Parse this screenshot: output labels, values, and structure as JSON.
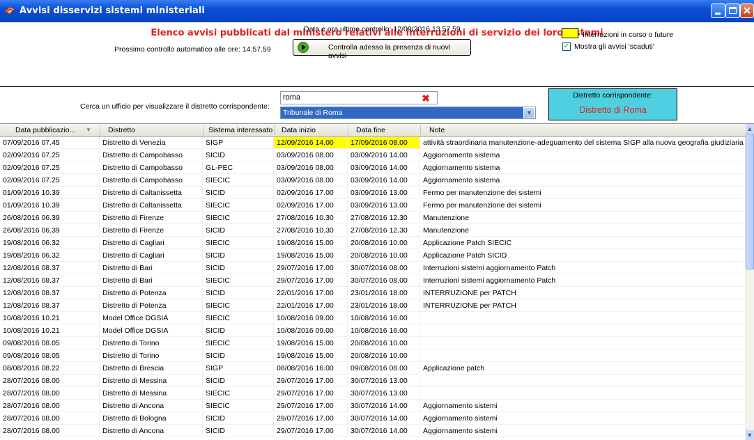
{
  "window": {
    "title": "Avvisi disservizi sistemi ministeriali",
    "buttons": [
      "minimize",
      "maximize",
      "close"
    ]
  },
  "header": {
    "title": "Elenco avvisi pubblicati dal ministero relativi alle interruzioni di servizio dei loro sistemi",
    "last_check": "Data e ora ultimo controllo:  12/09/2016 13.57.59",
    "next_check": "Prossimo controllo automatico alle ore: 14.57.59",
    "check_button": "Controlla adesso la presenza di nuovi avvisi",
    "legend_label": "Interruzioni in corso o future",
    "legend_color": "#ffff00",
    "show_expired_label": "Mostra gli avvisi 'scaduti'",
    "show_expired_checked": true
  },
  "search": {
    "label": "Cerca un ufficio per visualizzare il distretto corrispondente:",
    "value": "roma",
    "selected_office": "Tribunale di Roma",
    "district_label": "Distretto corrispondente:",
    "district_value": "Distretto di Roma"
  },
  "table": {
    "columns": [
      "Data pubblicazio...",
      "Distretto",
      "Sistema interessato",
      "Data inizio",
      "Data fine",
      "Note"
    ],
    "rows": [
      {
        "pub": "07/09/2016 07.45",
        "distretto": "Distretto di Venezia",
        "sistema": "SIGP",
        "inizio": "12/09/2016 14.00",
        "fine": "17/09/2016 08.00",
        "note": "attività straordinaria manutenzione-adeguamento del sistema SIGP alla nuova geografia giudiziaria ...",
        "highlight": true
      },
      {
        "pub": "02/09/2016 07.25",
        "distretto": "Distretto di Campobasso",
        "sistema": "SICID",
        "inizio": "03/09/2016 08.00",
        "fine": "03/09/2016 14.00",
        "note": "Aggiornamento sistema"
      },
      {
        "pub": "02/09/2016 07.25",
        "distretto": "Distretto di Campobasso",
        "sistema": "GL-PEC",
        "inizio": "03/09/2016 08.00",
        "fine": "03/09/2016 14.00",
        "note": "Aggiornamento sistema"
      },
      {
        "pub": "02/09/2016 07.25",
        "distretto": "Distretto di Campobasso",
        "sistema": "SIECIC",
        "inizio": "03/09/2016 08.00",
        "fine": "03/09/2016 14.00",
        "note": "Aggiornamento sistema"
      },
      {
        "pub": "01/09/2016 10.39",
        "distretto": "Distretto di Caltanissetta",
        "sistema": "SICID",
        "inizio": "02/09/2016 17.00",
        "fine": "03/09/2016 13.00",
        "note": "Fermo per manutenzione dei sistemi"
      },
      {
        "pub": "01/09/2016 10.39",
        "distretto": "Distretto di Caltanissetta",
        "sistema": "SIECIC",
        "inizio": "02/09/2016 17.00",
        "fine": "03/09/2016 13.00",
        "note": "Fermo per manutenzione dei sistemi"
      },
      {
        "pub": "26/08/2016 06.39",
        "distretto": "Distretto di Firenze",
        "sistema": "SIECIC",
        "inizio": "27/08/2016 10.30",
        "fine": "27/08/2016 12.30",
        "note": "Manutenzione"
      },
      {
        "pub": "26/08/2016 06.39",
        "distretto": "Distretto di Firenze",
        "sistema": "SICID",
        "inizio": "27/08/2016 10.30",
        "fine": "27/08/2016 12.30",
        "note": "Manutenzione"
      },
      {
        "pub": "19/08/2016 06.32",
        "distretto": "Distretto di Cagliari",
        "sistema": "SIECIC",
        "inizio": "19/08/2016 15.00",
        "fine": "20/08/2016 10.00",
        "note": "Applicazione Patch SIECIC"
      },
      {
        "pub": "19/08/2016 06.32",
        "distretto": "Distretto di Cagliari",
        "sistema": "SICID",
        "inizio": "19/08/2016 15.00",
        "fine": "20/08/2016 10.00",
        "note": "Applicazione Patch SICID"
      },
      {
        "pub": "12/08/2016 08.37",
        "distretto": "Distretto di Bari",
        "sistema": "SICID",
        "inizio": "29/07/2016 17.00",
        "fine": "30/07/2016 08.00",
        "note": "Interruzioni sistemi aggiornamento Patch"
      },
      {
        "pub": "12/08/2016 08.37",
        "distretto": "Distretto di Bari",
        "sistema": "SIECIC",
        "inizio": "29/07/2016 17.00",
        "fine": "30/07/2016 08.00",
        "note": "Interruzioni sistemi aggiornamento Patch"
      },
      {
        "pub": "12/08/2016 08.37",
        "distretto": "Distretto di Potenza",
        "sistema": "SICID",
        "inizio": "22/01/2016 17.00",
        "fine": "23/01/2016 18.00",
        "note": "INTERRUZIONE per PATCH"
      },
      {
        "pub": "12/08/2016 08.37",
        "distretto": "Distretto di Potenza",
        "sistema": "SIECIC",
        "inizio": "22/01/2016 17.00",
        "fine": "23/01/2016 18.00",
        "note": "INTERRUZIONE per PATCH"
      },
      {
        "pub": "10/08/2016 10.21",
        "distretto": "Model Office DGSIA",
        "sistema": "SIECIC",
        "inizio": "10/08/2016 09.00",
        "fine": "10/08/2016 16.00",
        "note": ""
      },
      {
        "pub": "10/08/2016 10.21",
        "distretto": "Model Office DGSIA",
        "sistema": "SICID",
        "inizio": "10/08/2016 09.00",
        "fine": "10/08/2016 16.00",
        "note": ""
      },
      {
        "pub": "09/08/2016 08.05",
        "distretto": "Distretto di Torino",
        "sistema": "SIECIC",
        "inizio": "19/08/2016 15.00",
        "fine": "20/08/2016 10.00",
        "note": ""
      },
      {
        "pub": "09/08/2016 08.05",
        "distretto": "Distretto di Torino",
        "sistema": "SICID",
        "inizio": "19/08/2016 15.00",
        "fine": "20/08/2016 10.00",
        "note": ""
      },
      {
        "pub": "08/08/2016 08.22",
        "distretto": "Distretto di Brescia",
        "sistema": "SIGP",
        "inizio": "08/08/2016 16.00",
        "fine": "09/08/2016 08.00",
        "note": "Applicazione patch"
      },
      {
        "pub": "28/07/2016 08.00",
        "distretto": "Distretto di Messina",
        "sistema": "SICID",
        "inizio": "29/07/2016 17.00",
        "fine": "30/07/2016 13.00",
        "note": ""
      },
      {
        "pub": "28/07/2016 08.00",
        "distretto": "Distretto di Messina",
        "sistema": "SIECIC",
        "inizio": "29/07/2016 17.00",
        "fine": "30/07/2016 13.00",
        "note": ""
      },
      {
        "pub": "28/07/2016 08.00",
        "distretto": "Distretto di Ancona",
        "sistema": "SIECIC",
        "inizio": "29/07/2016 17.00",
        "fine": "30/07/2016 14.00",
        "note": "Aggiornamento sistemi"
      },
      {
        "pub": "28/07/2016 08.00",
        "distretto": "Distretto di Bologna",
        "sistema": "SICID",
        "inizio": "29/07/2016 17.00",
        "fine": "30/07/2016 14.00",
        "note": "Aggiornamento sistemi"
      },
      {
        "pub": "28/07/2016 08.00",
        "distretto": "Distretto di Ancona",
        "sistema": "SICID",
        "inizio": "29/07/2016 17.00",
        "fine": "30/07/2016 14.00",
        "note": "Aggiornamento sistemi"
      }
    ]
  }
}
